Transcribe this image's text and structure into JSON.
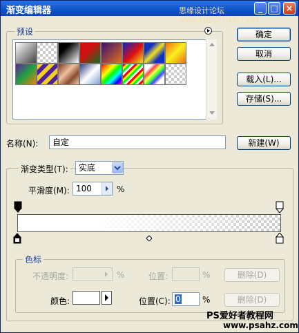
{
  "window": {
    "title": "渐变编辑器",
    "watermark_top": "思缘设计论坛 www.MISSYUAN.COM"
  },
  "titlebar_buttons": [
    "_",
    "□",
    "×"
  ],
  "presets": {
    "legend": "预设",
    "menu_icon": "circle-arrow-icon",
    "swatches": [
      "black-white",
      "transparent-stripes",
      "black-to-white",
      "red-green",
      "violet-orange",
      "blue-red-yellow",
      "blue-yellow-blue",
      "orange-yellow-orange",
      "violet-green-orange",
      "yellow-violet-stripes",
      "copper",
      "chrome",
      "spectrum",
      "rainbow-transparent",
      "transparent-rainbow",
      "transparent-stripes-2"
    ]
  },
  "buttons": {
    "ok": "确定",
    "cancel": "取消",
    "load": "载入(L)...",
    "save": "存储(S)...",
    "new": "新建(W)"
  },
  "name": {
    "label": "名称(N):",
    "value": "自定"
  },
  "gradient_type": {
    "legend_label": "渐变类型(T):",
    "value": "实底",
    "smoothness_label": "平滑度(M):",
    "smoothness_value": "100",
    "percent": "%"
  },
  "stops": {
    "legend": "色标",
    "opacity_label": "不透明度:",
    "opacity_unit": "%",
    "opacity_location_label": "位置:",
    "opacity_location_unit": "%",
    "opacity_delete": "删除(D)",
    "color_label": "颜色:",
    "color_location_label": "位置(C):",
    "color_location_value": "0",
    "color_location_unit": "%",
    "color_delete": "删除(D)"
  },
  "watermark_bottom": {
    "line1": "PS爱好者教程网",
    "line2": "www.psahz.com"
  },
  "colors": {
    "title_bar": "#0F52C8",
    "dialog_bg": "#ECE9D8",
    "group_legend": "#1C3F94"
  }
}
